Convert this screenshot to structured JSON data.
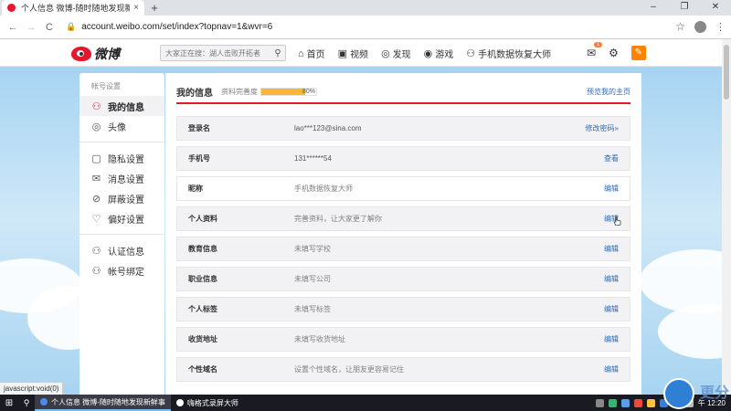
{
  "browser": {
    "tab_title": "个人信息 微博-随时随地发现新鲜事",
    "tab_close": "×",
    "new_tab": "+",
    "win_min": "–",
    "win_max": "❐",
    "win_close": "✕",
    "back": "←",
    "forward": "→",
    "reload": "C",
    "lock": "🔒",
    "url": "account.weibo.com/set/index?topnav=1&wvr=6",
    "star": "☆",
    "kebab": "⋮",
    "status_url": "javascript:void(0)"
  },
  "weibo": {
    "logo_text": "微博",
    "search_placeholder": "大家正在搜：湖人击败开拓者",
    "nav": [
      {
        "label": "首页",
        "icon": "⌂"
      },
      {
        "label": "视频",
        "icon": "▣"
      },
      {
        "label": "发现",
        "icon": "◎"
      },
      {
        "label": "游戏",
        "icon": "◉"
      },
      {
        "label": "手机数据恢复大师",
        "icon": "⚇"
      }
    ],
    "badge": "1"
  },
  "sidebar": {
    "header": "帐号设置",
    "items": [
      {
        "label": "我的信息",
        "icon": "⚇"
      },
      {
        "label": "头像",
        "icon": "◎"
      },
      {
        "label": "隐私设置",
        "icon": "▢"
      },
      {
        "label": "消息设置",
        "icon": "✉"
      },
      {
        "label": "屏蔽设置",
        "icon": "⊘"
      },
      {
        "label": "偏好设置",
        "icon": "♡"
      },
      {
        "label": "认证信息",
        "icon": "⚇"
      },
      {
        "label": "帐号绑定",
        "icon": "⚇"
      }
    ]
  },
  "main": {
    "title": "我的信息",
    "completeness_label": "资料完善度",
    "completeness_pct": "80%",
    "completeness_value": 0.8,
    "preview_link": "预览我的主页",
    "rows": [
      {
        "key": "登录名",
        "value": "lao***123@sina.com",
        "action": "修改密码»"
      },
      {
        "key": "手机号",
        "value": "131******54",
        "action": "查看"
      },
      {
        "key": "昵称",
        "value": "手机数据恢复大师",
        "action": "编辑"
      },
      {
        "key": "个人资料",
        "value": "完善资料，让大家更了解你",
        "action": "编辑"
      },
      {
        "key": "教育信息",
        "value": "未填写学校",
        "action": "编辑"
      },
      {
        "key": "职业信息",
        "value": "未填写公司",
        "action": "编辑"
      },
      {
        "key": "个人标签",
        "value": "未填写标签",
        "action": "编辑"
      },
      {
        "key": "收货地址",
        "value": "未填写收货地址",
        "action": "编辑"
      },
      {
        "key": "个性域名",
        "value": "设置个性域名，让朋友更容易记住",
        "action": "编辑"
      }
    ]
  },
  "taskbar": {
    "start": "⊞",
    "search": "⚲",
    "apps": [
      {
        "label": "个人信息 微博-随时随地发现新鲜事",
        "color": "#4a8af4"
      },
      {
        "label": "嗨格式录屏大师",
        "color": "#ffffff"
      }
    ],
    "time": "午 12:20",
    "watermark_text": "更分"
  }
}
